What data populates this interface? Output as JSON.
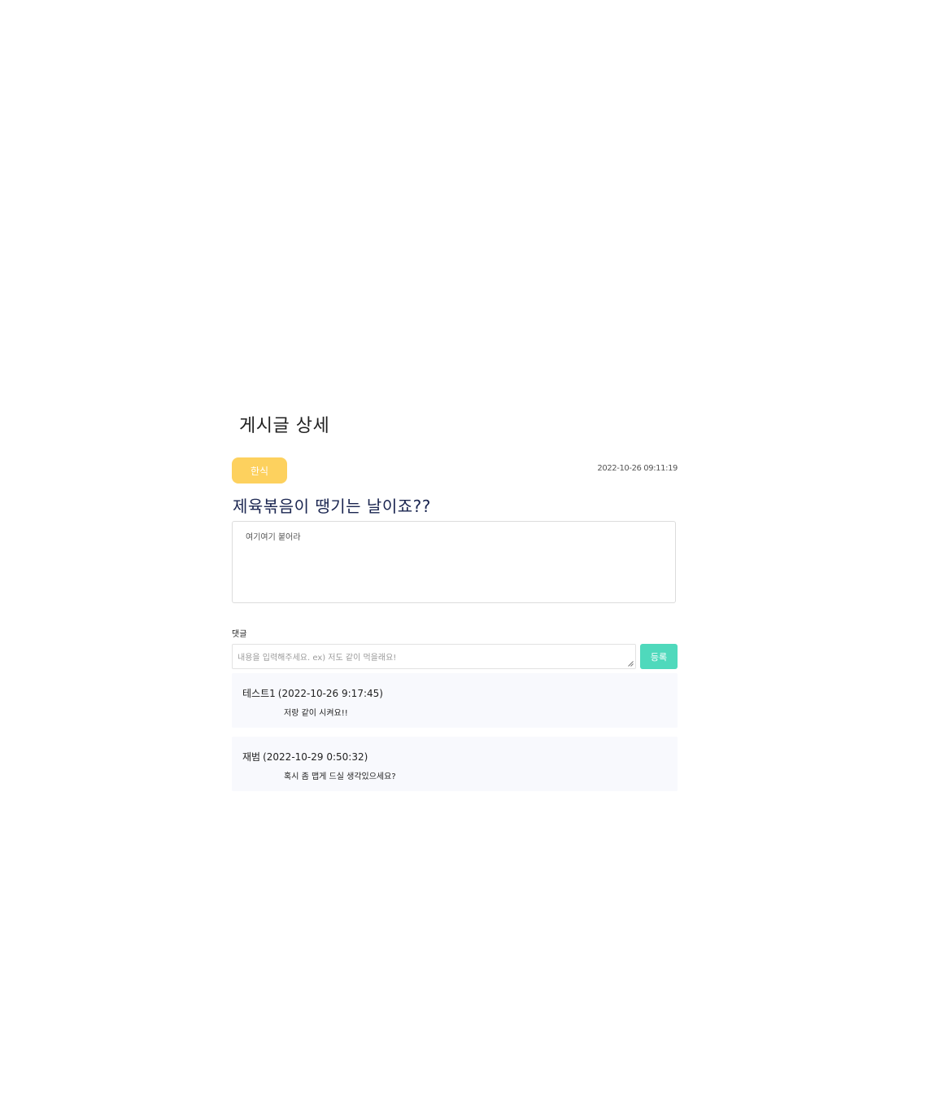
{
  "page": {
    "heading": "게시글 상세"
  },
  "post": {
    "category": "한식",
    "date": "2022-10-26 09:11:19",
    "title": "제육볶음이 땡기는 날이죠??",
    "body": "여기여기 붙어라"
  },
  "comment_form": {
    "label": "댓글",
    "placeholder": "내용을 입력해주세요. ex) 저도 같이 먹을래요!",
    "value": "",
    "submit_label": "등록"
  },
  "comments": [
    {
      "author": "테스트1",
      "timestamp": "(2022-10-26 9:17:45)",
      "text": "저랑 같이 시켜요!!"
    },
    {
      "author": "재범",
      "timestamp": "(2022-10-29 0:50:32)",
      "text": "혹시 좀 맵게 드실 생각있으세요?"
    }
  ],
  "colors": {
    "category_badge": "#fdd15e",
    "submit_button": "#4fd9bc",
    "title": "#1a2550",
    "comment_bg": "#f8f9fd"
  }
}
